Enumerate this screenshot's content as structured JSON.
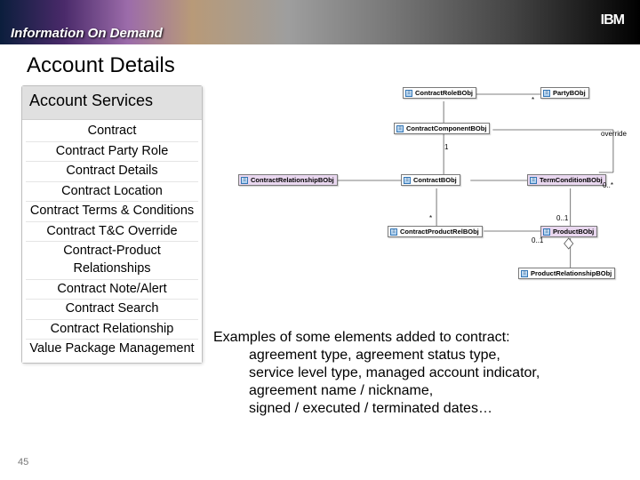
{
  "banner": {
    "title": "Information On Demand",
    "logo": "IBM"
  },
  "slide_title": "Account Details",
  "panel": {
    "header": "Account Services",
    "items": [
      "Contract",
      "Contract Party Role",
      "Contract Details",
      "Contract Location",
      "Contract Terms & Conditions",
      "Contract T&C Override",
      "Contract-Product Relationships",
      "Contract Note/Alert",
      "Contract Search",
      "Contract Relationship",
      "Value Package Management"
    ]
  },
  "uml": {
    "contractRole": "ContractRoleBObj",
    "party": "PartyBObj",
    "contractComponent": "ContractComponentBObj",
    "override": "override",
    "contractRelationship": "ContractRelationshipBObj",
    "contract": "ContractBObj",
    "termCondition": "TermConditionBObj",
    "contractProductRel": "ContractProductRelBObj",
    "product": "ProductBObj",
    "productRelationship": "ProductRelationshipBObj",
    "one": "1",
    "zero_one": "0..1",
    "zero_star": "0..*",
    "zero_one2": "0..1",
    "star1": "*",
    "star2": "*"
  },
  "examples": {
    "lead": "Examples of some elements added to contract:",
    "l1": "agreement type, agreement status type,",
    "l2": "service level type, managed account indicator,",
    "l3": "agreement name / nickname,",
    "l4": "signed / executed / terminated dates…"
  },
  "page_number": "45"
}
